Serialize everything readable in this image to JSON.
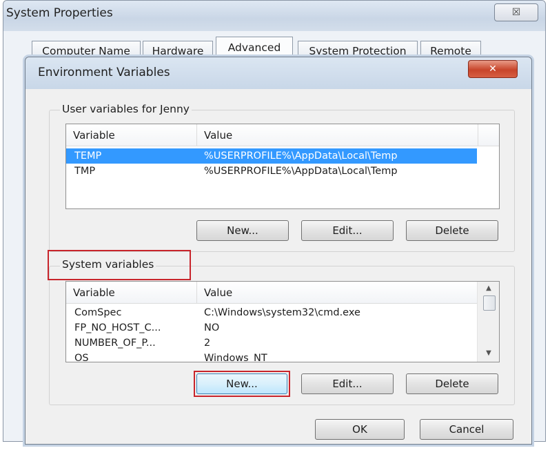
{
  "outer_window": {
    "title": "System Properties",
    "close_glyph": "☒",
    "tabs": [
      {
        "label": "Computer Name"
      },
      {
        "label": "Hardware"
      },
      {
        "label": "Advanced"
      },
      {
        "label": "System Protection"
      },
      {
        "label": "Remote"
      }
    ],
    "active_tab": "Advanced"
  },
  "dialog": {
    "title": "Environment Variables",
    "close_glyph": "✕",
    "user_vars": {
      "group_label": "User variables for Jenny",
      "columns": [
        "Variable",
        "Value"
      ],
      "rows": [
        {
          "variable": "TEMP",
          "value": "%USERPROFILE%\\AppData\\Local\\Temp",
          "selected": true
        },
        {
          "variable": "TMP",
          "value": "%USERPROFILE%\\AppData\\Local\\Temp",
          "selected": false
        }
      ],
      "buttons": {
        "new": "New...",
        "edit": "Edit...",
        "delete": "Delete"
      }
    },
    "system_vars": {
      "group_label": "System variables",
      "columns": [
        "Variable",
        "Value"
      ],
      "rows": [
        {
          "variable": "ComSpec",
          "value": "C:\\Windows\\system32\\cmd.exe"
        },
        {
          "variable": "FP_NO_HOST_C...",
          "value": "NO"
        },
        {
          "variable": "NUMBER_OF_P...",
          "value": "2"
        },
        {
          "variable": "OS",
          "value": "Windows_NT"
        }
      ],
      "buttons": {
        "new": "New...",
        "edit": "Edit...",
        "delete": "Delete"
      }
    },
    "footer_buttons": {
      "ok": "OK",
      "cancel": "Cancel"
    }
  },
  "colors": {
    "selection": "#3399ff",
    "highlight_annotation": "#c8242b"
  }
}
